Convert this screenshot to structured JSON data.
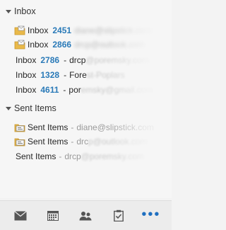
{
  "inbox": {
    "header": "Inbox",
    "items": [
      {
        "label": "Inbox",
        "count": "2451",
        "account": "diane@slipstick.com",
        "icon": "folder-mail-icon"
      },
      {
        "label": "Inbox",
        "count": "2866",
        "account": "drcp@outlook.com",
        "icon": "folder-mail-icon"
      },
      {
        "label": "Inbox",
        "count": "2786",
        "sep": "-",
        "account_prefix": "drcp",
        "account": "@poremsky.com"
      },
      {
        "label": "Inbox",
        "count": "1328",
        "sep": "-",
        "account_prefix": "Fore",
        "account": "st-Poplars"
      },
      {
        "label": "Inbox",
        "count": "4611",
        "sep": "-",
        "account_prefix": "por",
        "account": "emsky@gmail.com"
      }
    ]
  },
  "sent": {
    "header": "Sent Items",
    "items": [
      {
        "label": "Sent Items",
        "sep": "-",
        "account": "diane@slipstick.com",
        "icon": "folder-sent-icon"
      },
      {
        "label": "Sent Items",
        "sep": "-",
        "account_prefix": "drc",
        "account": "p@outlook.com",
        "icon": "folder-sent-icon"
      },
      {
        "label": "Sent Items",
        "sep": "-",
        "account_prefix": "drcp",
        "account": "@poremsky.com"
      }
    ]
  },
  "nav": {
    "mail": "mail-icon",
    "calendar": "calendar-icon",
    "people": "people-icon",
    "tasks": "tasks-icon",
    "more": "•••",
    "accent": "#1e6fc0"
  }
}
